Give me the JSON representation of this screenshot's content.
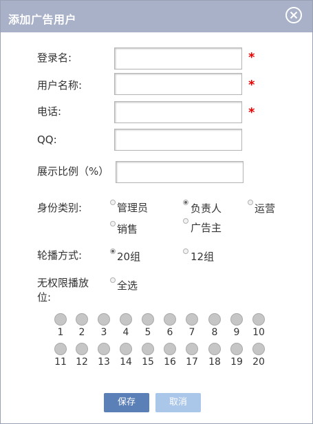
{
  "dialog": {
    "title": "添加广告用户"
  },
  "form": {
    "login_label": "登录名:",
    "username_label": "用户名称:",
    "phone_label": "电话:",
    "qq_label": "QQ:",
    "ratio_label": "展示比例（%）",
    "required_mark": "*",
    "role_label": "身份类别:",
    "roles": [
      {
        "label": "管理员",
        "selected": false
      },
      {
        "label": "负责人",
        "selected": true
      },
      {
        "label": "运营",
        "selected": false
      },
      {
        "label": "销售",
        "selected": false
      },
      {
        "label": "广告主",
        "selected": false
      }
    ],
    "rotation_label": "轮播方式:",
    "rotations": [
      {
        "label": "20组",
        "selected": true
      },
      {
        "label": "12组",
        "selected": false
      }
    ],
    "unrestricted_label_line1": "无权限播放",
    "unrestricted_label_line2": "位:",
    "select_all_label": "全选",
    "slots": [
      "1",
      "2",
      "3",
      "4",
      "5",
      "6",
      "7",
      "8",
      "9",
      "10",
      "11",
      "12",
      "13",
      "14",
      "15",
      "16",
      "17",
      "18",
      "19",
      "20"
    ]
  },
  "buttons": {
    "save": "保存",
    "cancel": "取消"
  },
  "colors": {
    "titlebar": "#a9b1c9",
    "required": "#e60000",
    "save_button": "#5b7fb7",
    "cancel_button": "#aac6e8"
  }
}
